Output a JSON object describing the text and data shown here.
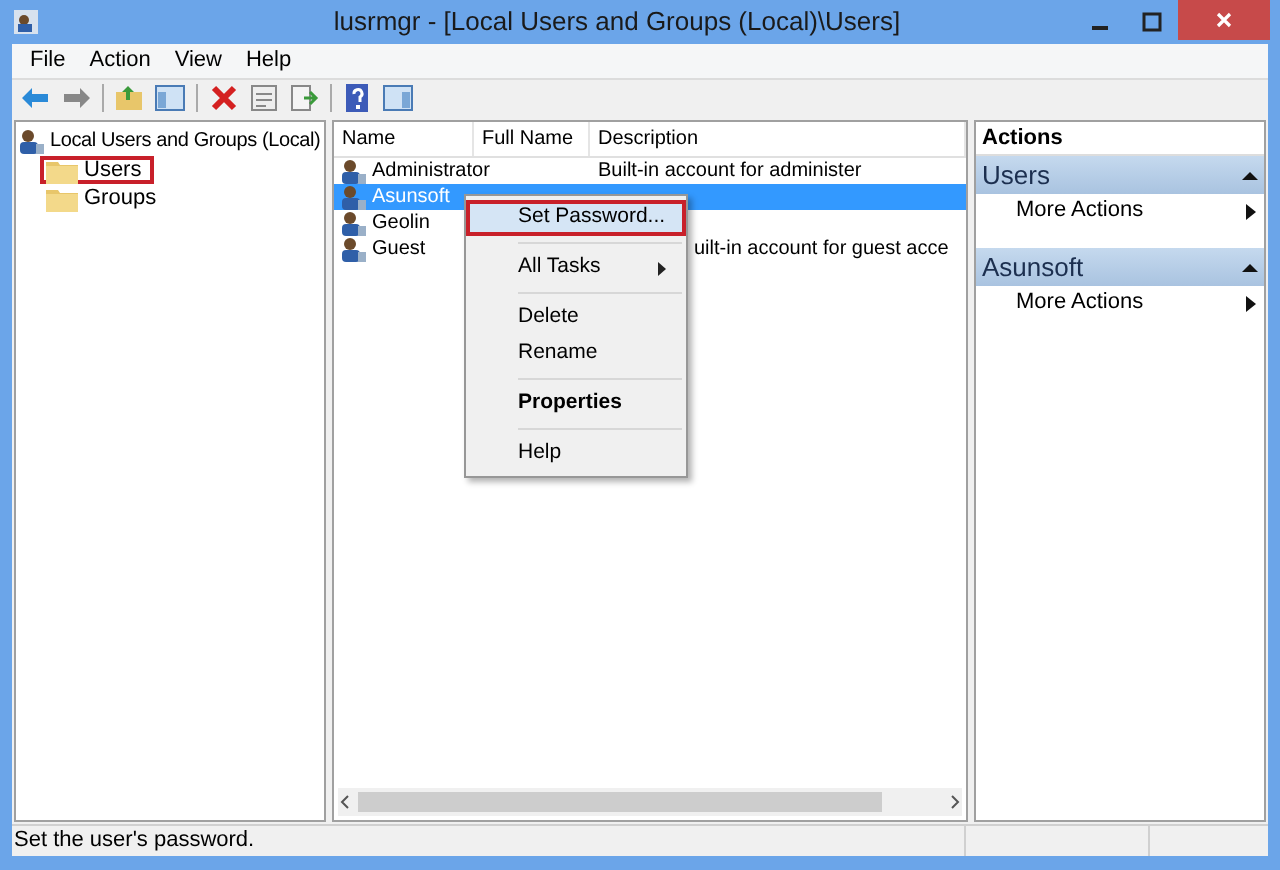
{
  "window": {
    "title": "lusrmgr - [Local Users and Groups (Local)\\Users]"
  },
  "menu_bar": [
    "File",
    "Action",
    "View",
    "Help"
  ],
  "tree": {
    "label": "Local Users and Groups (Local)",
    "children": [
      {
        "label": "Users",
        "highlighted": true
      },
      {
        "label": "Groups",
        "highlighted": false
      }
    ]
  },
  "list": {
    "columns": [
      "Name",
      "Full Name",
      "Description"
    ],
    "rows": [
      {
        "name": "Administrator",
        "description": "Built-in account for administer",
        "selected": false
      },
      {
        "name": "Asunsoft",
        "description": "",
        "selected": true
      },
      {
        "name": "Geolin",
        "description": "",
        "selected": false
      },
      {
        "name": "Guest",
        "description": "uilt-in account for guest acce",
        "selected": false
      }
    ]
  },
  "context_menu": [
    {
      "kind": "item",
      "label": "Set Password...",
      "highlighted": true,
      "bold": false,
      "submenu": false
    },
    {
      "kind": "separator"
    },
    {
      "kind": "item",
      "label": "All Tasks",
      "highlighted": false,
      "bold": false,
      "submenu": true
    },
    {
      "kind": "separator"
    },
    {
      "kind": "item",
      "label": "Delete",
      "highlighted": false,
      "bold": false,
      "submenu": false
    },
    {
      "kind": "item",
      "label": "Rename",
      "highlighted": false,
      "bold": false,
      "submenu": false
    },
    {
      "kind": "separator"
    },
    {
      "kind": "item",
      "label": "Properties",
      "highlighted": false,
      "bold": true,
      "submenu": false
    },
    {
      "kind": "separator"
    },
    {
      "kind": "item",
      "label": "Help",
      "highlighted": false,
      "bold": false,
      "submenu": false
    }
  ],
  "actions": {
    "title": "Actions",
    "sections": [
      {
        "title": "Users",
        "items": [
          "More Actions"
        ]
      },
      {
        "title": "Asunsoft",
        "items": [
          "More Actions"
        ]
      }
    ]
  },
  "status_bar": "Set the user's password."
}
